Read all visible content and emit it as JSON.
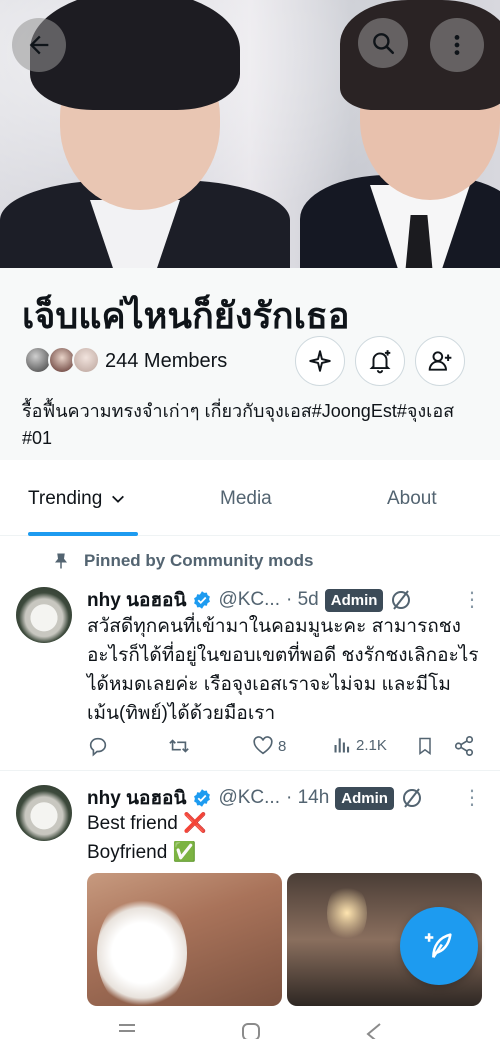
{
  "community": {
    "title": "เจ็บแค่ไหนก็ยังรักเธอ",
    "members": "244 Members",
    "description": "รื้อฟื้นความทรงจำเก่าๆ เกี่ยวกับจุงเอส#JoongEst#จุงเอส #01"
  },
  "tabs": [
    {
      "label": "Trending"
    },
    {
      "label": "Media"
    },
    {
      "label": "About"
    }
  ],
  "pinned_label": "Pinned by Community mods",
  "tweets": [
    {
      "name": "nhy นอฮอนิ",
      "handle": "@KC...",
      "time": "· 5d",
      "badge": "Admin",
      "text": "สวัสดีทุกคนที่เข้ามาในคอมมูนะคะ สามารถชงอะไรก็ได้ที่อยู่ในขอบเขตที่พอดี ชงรักชงเลิกอะไรได้หมดเลยค่ะ เรือจุงเอสเราจะไม่จม และมีโมเม้น(ทิพย์)ได้ด้วยมือเรา",
      "likes": "8",
      "views": "2.1K"
    },
    {
      "name": "nhy นอฮอนิ",
      "handle": "@KC...",
      "time": "· 14h",
      "badge": "Admin",
      "line1": "Best friend ❌",
      "line2": "Boyfriend ✅"
    }
  ],
  "icons": {
    "back": "arrow-left-icon",
    "search": "search-icon",
    "more": "more-vertical-icon",
    "sparkle": "sparkle-icon",
    "bell": "bell-plus-icon",
    "invite": "add-person-icon",
    "pin": "pin-icon",
    "verified": "verified-badge-icon",
    "reply": "reply-icon",
    "retweet": "retweet-icon",
    "like": "heart-icon",
    "views": "views-icon",
    "bookmark": "bookmark-icon",
    "share": "share-icon",
    "compose": "compose-icon"
  },
  "colors": {
    "accent": "#1d9bf0",
    "admin_badge": "#3c4b58",
    "muted": "#536471"
  }
}
